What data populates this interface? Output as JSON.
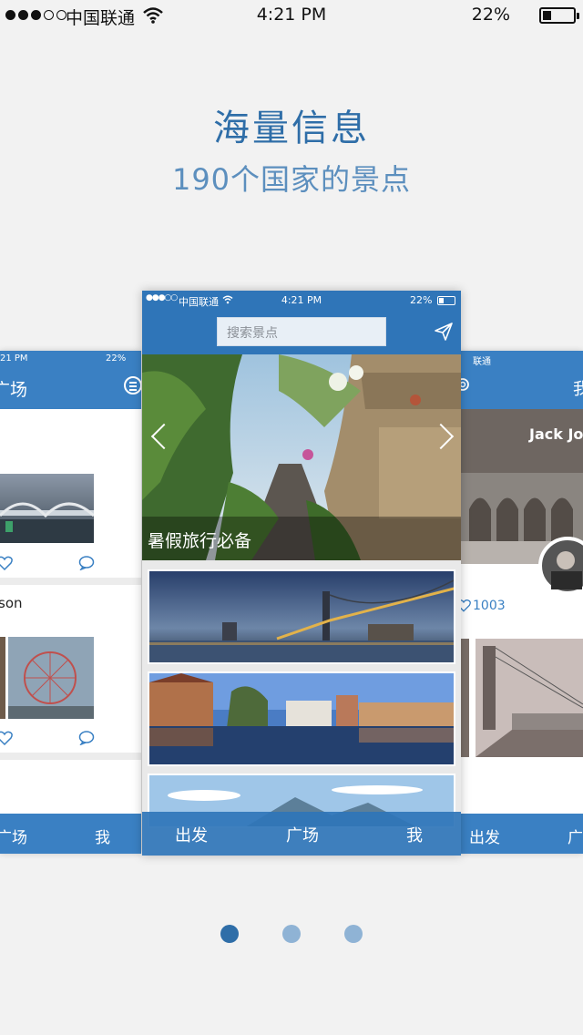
{
  "status_bar": {
    "carrier": "中国联通",
    "time": "4:21 PM",
    "battery": "22%"
  },
  "heading": {
    "title": "海量信息",
    "subtitle": "190个国家的景点"
  },
  "center_phone": {
    "status_bar": {
      "carrier": "中国联通",
      "time": "4:21 PM",
      "battery": "22%"
    },
    "search_placeholder": "搜索景点",
    "hero_caption": "暑假旅行必备",
    "tabs": [
      "出发",
      "广场",
      "我"
    ]
  },
  "left_card": {
    "status_battery": "22%",
    "title": "广场",
    "name_fragment": "son",
    "tabs": [
      "广场",
      "我"
    ]
  },
  "right_card": {
    "status_carrier": "联通",
    "title": "我",
    "profile_name": "Jack Jo",
    "likes": "1003",
    "tabs": [
      "出发",
      "广"
    ]
  },
  "pager": {
    "count": 3,
    "active": 0,
    "active_color": "#2f6ea8",
    "inactive_color": "#8fb3d5"
  },
  "colors": {
    "brand_blue": "#2f75b8",
    "heading_blue": "#2f6ea8"
  }
}
